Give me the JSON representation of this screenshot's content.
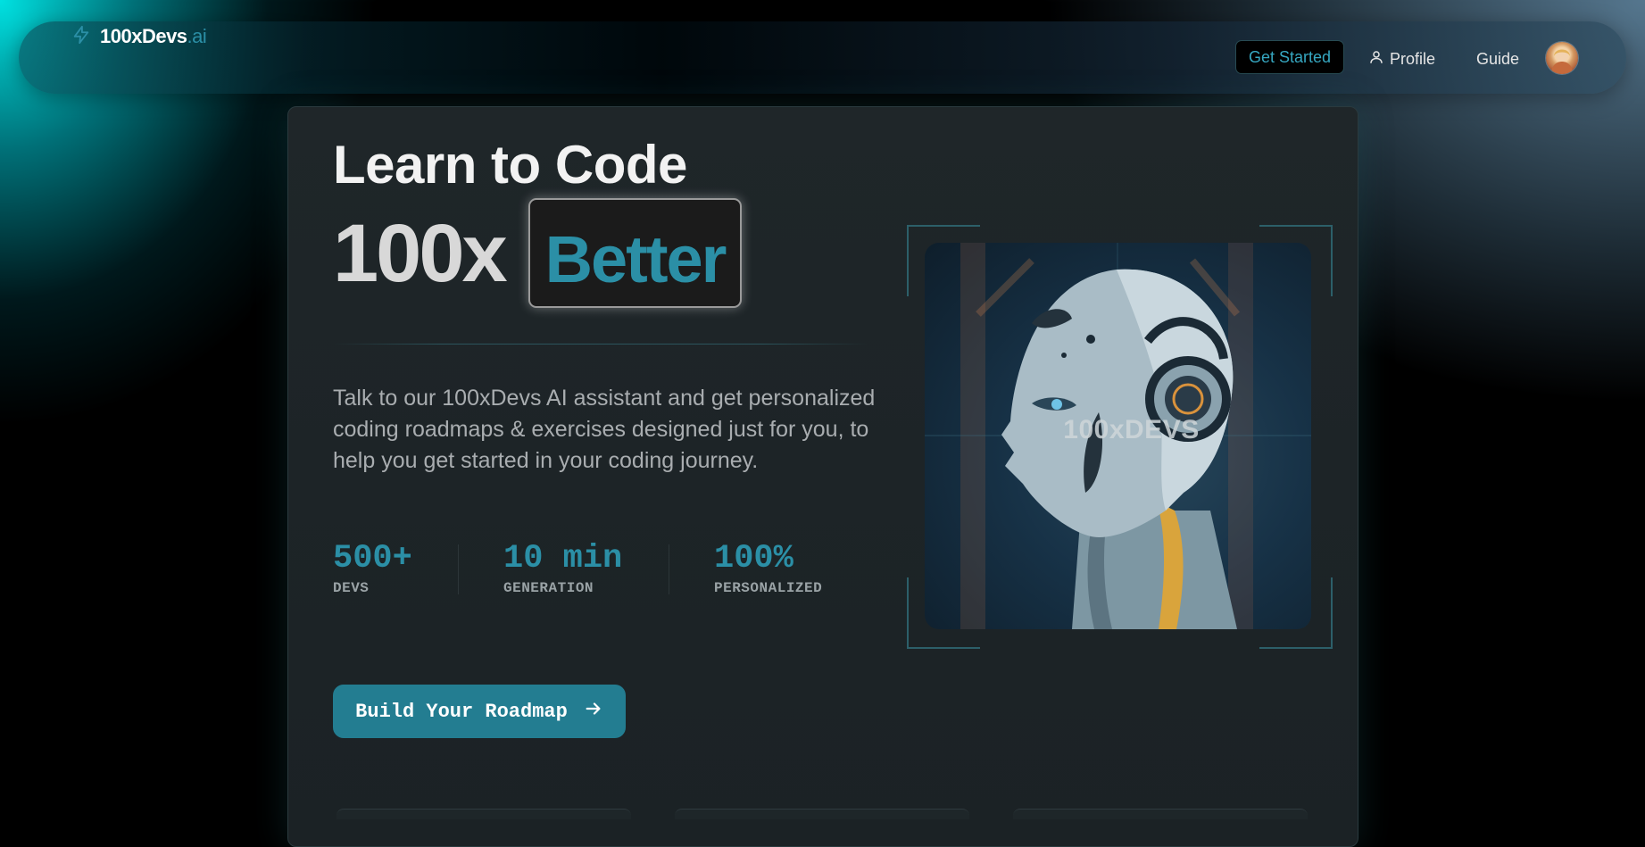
{
  "nav": {
    "brand_name": "100xDevs",
    "brand_suffix": ".ai",
    "get_started": "Get Started",
    "profile": "Profile",
    "guide": "Guide"
  },
  "hero": {
    "line1": "Learn to Code",
    "line2_prefix": "100x",
    "line2_highlight": "Better",
    "description": "Talk to our 100xDevs AI assistant and get personalized coding roadmaps & exercises designed just for you, to help you get started in your coding journey.",
    "stats": [
      {
        "value": "500+",
        "label": "DEVS"
      },
      {
        "value": "10 min",
        "label": "GENERATION"
      },
      {
        "value": "100%",
        "label": "PERSONALIZED"
      }
    ],
    "cta": "Build Your Roadmap"
  },
  "image": {
    "overlay_text": "100xDEVS"
  },
  "colors": {
    "accent": "#2b8fa6",
    "cta": "#237d91",
    "card": "#1f2629"
  },
  "icons": [
    "bolt-icon",
    "user-icon",
    "arrow-right-icon"
  ]
}
